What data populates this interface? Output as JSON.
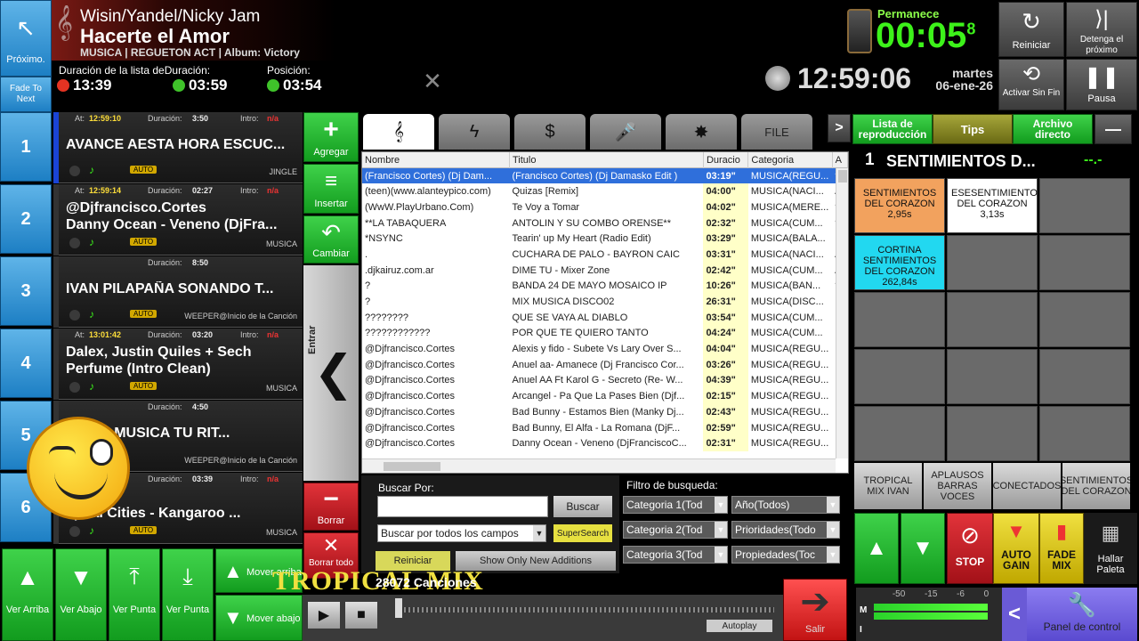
{
  "topLeft": {
    "next_label": "Próximo.",
    "fade_label": "Fade To Next"
  },
  "nowPlaying": {
    "artist": "Wisin/Yandel/Nicky Jam",
    "title": "Hacerte el Amor",
    "info": "MUSICA | REGUETON ACT | Album: Victory",
    "list_label": "Duración de la lista de",
    "dur_label": "Duración:",
    "pos_label": "Posición:",
    "list_time": "13:39",
    "dur_time": "03:59",
    "pos_time": "03:54"
  },
  "remain": {
    "label": "Permanece",
    "value": "00:05",
    "tenths": "8"
  },
  "clock": {
    "time": "12:59:06",
    "day": "martes",
    "date": "06-ene-26"
  },
  "topButtons": [
    {
      "label": "Reiniciar"
    },
    {
      "label": "Detenga el próximo"
    },
    {
      "label": "Activar Sin Fin"
    },
    {
      "label": "Pausa"
    }
  ],
  "cues": [
    {
      "num": "1",
      "at_label": "At:",
      "at": "12:59:10",
      "dur_label": "Duración:",
      "dur": "3:50",
      "intro_label": "Intro:",
      "intro": "n/a",
      "line1": "AVANCE AESTA HORA ESCUC...",
      "line2": "",
      "tag": "AUTO",
      "category": "JINGLE",
      "bar": "#1a44d6"
    },
    {
      "num": "2",
      "at_label": "At:",
      "at": "12:59:14",
      "dur_label": "Duración:",
      "dur": "02:27",
      "intro_label": "Intro:",
      "intro": "n/a",
      "line1": "@Djfrancisco.Cortes",
      "line2": "Danny Ocean - Veneno (DjFra...",
      "tag": "AUTO",
      "category": "MUSICA",
      "bar": "#333"
    },
    {
      "num": "3",
      "at_label": "",
      "at": "",
      "dur_label": "Duración:",
      "dur": "8:50",
      "intro_label": "",
      "intro": "",
      "line1": "IVAN PILAPAÑA SONANDO T...",
      "line2": "",
      "tag": "AUTO",
      "category": "WEEPER@Inicio de la Canción",
      "bar": "#333"
    },
    {
      "num": "4",
      "at_label": "At:",
      "at": "13:01:42",
      "dur_label": "Duración:",
      "dur": "03:20",
      "intro_label": "Intro:",
      "intro": "n/a",
      "line1": "Dalex, Justin Quiles + Sech",
      "line2": "Perfume (Intro Clean)",
      "tag": "AUTO",
      "category": "MUSICA",
      "bar": "#333"
    },
    {
      "num": "5",
      "at_label": "",
      "at": "",
      "dur_label": "Duración:",
      "dur": "4:50",
      "intro_label": "",
      "intro": "",
      "line1": "OR  TU MUSICA TU RIT...",
      "line2": "",
      "tag": "",
      "category": "WEEPER@Inicio de la Canción",
      "bar": "#333"
    },
    {
      "num": "6",
      "at_label": "At:",
      "at": "",
      "dur_label": "Duración:",
      "dur": "03:39",
      "intro_label": "Intro:",
      "intro": "n/a",
      "line1": "asko",
      "line2": "apital Cities - Kangaroo ...",
      "tag": "AUTO",
      "category": "MUSICA",
      "bar": "#333"
    }
  ],
  "sideActions": [
    {
      "label": "Agregar",
      "icon": "+"
    },
    {
      "label": "Insertar",
      "icon": "≡"
    },
    {
      "label": "Cambiar",
      "icon": "↶"
    }
  ],
  "enter_label": "Entrar",
  "borrar_label": "Borrar",
  "borrar_todo_label": "Borrar todo",
  "bottomNav": [
    {
      "label": "Ver Arriba"
    },
    {
      "label": "Ver Abajo"
    },
    {
      "label": "Ver Punta"
    },
    {
      "label": "Ver Punta"
    }
  ],
  "move_up": "Mover arriba",
  "move_down": "Mover abajo",
  "tabs": [
    "𝄞",
    "ϟ",
    "$",
    "🎤",
    "✸",
    "FILE"
  ],
  "table": {
    "headers": [
      "Nombre",
      "Titulo",
      "Duracio",
      "Categoria",
      "A"
    ],
    "rows": [
      [
        "(Francisco Cortes) (Dj Dam...",
        "(Francisco Cortes) (Dj Damasko Edit )",
        "03:19\"",
        "MUSICA(REGU...",
        "?"
      ],
      [
        "(teen)(www.alanteypico.com)",
        "Quizas [Remix]",
        "04:00\"",
        "MUSICA(NACI...",
        "A"
      ],
      [
        "(WwW.PlayUrbano.Com)",
        "Te Voy a Tomar",
        "04:02\"",
        "MUSICA(MERE...",
        "?"
      ],
      [
        "**LA TABAQUERA",
        "ANTOLIN Y SU COMBO ORENSE**",
        "02:32\"",
        "MUSICA(CUM...",
        "?"
      ],
      [
        "*NSYNC",
        "Tearin' up My Heart (Radio Edit)",
        "03:29\"",
        "MUSICA(BALA...",
        "E"
      ],
      [
        ".",
        "CUCHARA DE PALO - BAYRON CAIC",
        "03:31\"",
        "MUSICA(NACI...",
        "A"
      ],
      [
        ".djkairuz.com.ar",
        "DIME TU - Mixer Zone",
        "02:42\"",
        "MUSICA(CUM...",
        "A"
      ],
      [
        "?",
        "BANDA 24 DE MAYO MOSAICO IP",
        "10:26\"",
        "MUSICA(BAN...",
        "?"
      ],
      [
        "?",
        "MIX MUSICA DISCO02",
        "26:31\"",
        "MUSICA(DISC...",
        ""
      ],
      [
        "????????",
        "QUE SE VAYA AL DIABLO",
        "03:54\"",
        "MUSICA(CUM...",
        ""
      ],
      [
        "????????????",
        "POR QUE TE QUIERO TANTO",
        "04:24\"",
        "MUSICA(CUM...",
        ""
      ],
      [
        "@Djfrancisco.Cortes",
        "Alexis y fido - Subete Vs Lary Over S...",
        "04:04\"",
        "MUSICA(REGU...",
        "@"
      ],
      [
        "@Djfrancisco.Cortes",
        "Anuel aa- Amanece (Dj Francisco Cor...",
        "03:26\"",
        "MUSICA(REGU...",
        "@"
      ],
      [
        "@Djfrancisco.Cortes",
        "Anuel AA Ft Karol G - Secreto (Re- W...",
        "04:39\"",
        "MUSICA(REGU...",
        "@"
      ],
      [
        "@Djfrancisco.Cortes",
        "Arcangel - Pa Que La Pases Bien (Djf...",
        "02:15\"",
        "MUSICA(REGU...",
        "@"
      ],
      [
        "@Djfrancisco.Cortes",
        "Bad Bunny - Estamos Bien (Manky Dj...",
        "02:43\"",
        "MUSICA(REGU...",
        "@"
      ],
      [
        "@Djfrancisco.Cortes",
        "Bad Bunny, El Alfa - La Romana (DjF...",
        "02:59\"",
        "MUSICA(REGU...",
        "@"
      ],
      [
        "@Djfrancisco.Cortes",
        "Danny Ocean - Veneno (DjFranciscoC...",
        "02:31\"",
        "MUSICA(REGU...",
        "@"
      ]
    ]
  },
  "search": {
    "label": "Buscar Por:",
    "button": "Buscar",
    "scope": "Buscar por todos los campos",
    "super": "SuperSearch",
    "reset": "Reiniciar",
    "new_only": "Show Only New Additions",
    "count": "28072 Canciones",
    "watermark": "TROPICAL MIX",
    "autoplay": "Autoplay"
  },
  "filters": {
    "label": "Filtro de busqueda:",
    "cat1": "Categoria 1(Tod",
    "cat2": "Categoria 2(Tod",
    "cat3": "Categoria 3(Tod",
    "year": "Año(Todos)",
    "prio": "Prioridades(Todo",
    "props": "Propiedades(Toc"
  },
  "salir_label": "Salir",
  "rightTabs": [
    {
      "label": "Lista de reproducción"
    },
    {
      "label": "Tips"
    },
    {
      "label": "Archivo directo"
    }
  ],
  "cart": {
    "header_num": "1",
    "header_title": "SENTIMIENTOS D...",
    "header_time": "--.-",
    "items": [
      {
        "text": "SENTIMIENTOS DEL CORAZON",
        "time": "2,95s",
        "bg": "#f2a25e"
      },
      {
        "text": "ESESENTIMIENTO DEL CORAZON",
        "time": "3,13s",
        "bg": "#ffffff"
      },
      {
        "text": "",
        "time": "",
        "bg": "#6a6a6a"
      },
      {
        "text": "CORTINA SENTIMIENTOS DEL CORAZON",
        "time": "262,84s",
        "bg": "#22d8f0"
      }
    ],
    "bottom": [
      "TROPICAL MIX IVAN",
      "APLAUSOS BARRAS VOCES",
      "CONECTADOS",
      "SENTIMIENTOS DEL CORAZON"
    ]
  },
  "controls": {
    "stop": "STOP",
    "autogain": "AUTO GAIN",
    "fademix": "FADE MIX",
    "hallar": "Hallar Paleta"
  },
  "meter": {
    "labels": [
      "-50",
      "-15",
      "-6",
      "0"
    ],
    "m": "M",
    "i": "I"
  },
  "panel_label": "Panel de control"
}
